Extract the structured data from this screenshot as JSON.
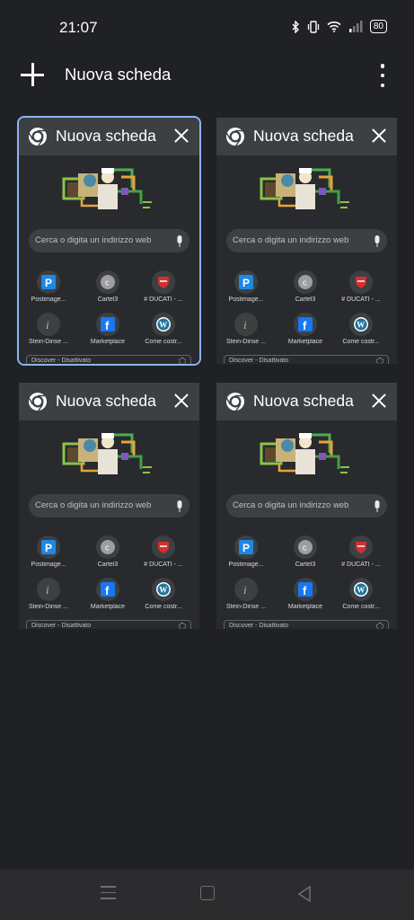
{
  "status": {
    "time": "21:07",
    "battery": "80"
  },
  "toolbar": {
    "title": "Nuova scheda"
  },
  "tabs": [
    {
      "title": "Nuova scheda",
      "selected": true
    },
    {
      "title": "Nuova scheda",
      "selected": false
    },
    {
      "title": "Nuova scheda",
      "selected": false
    },
    {
      "title": "Nuova scheda",
      "selected": false
    }
  ],
  "ntp": {
    "search_placeholder": "Cerca o digita un indirizzo web",
    "shortcuts": [
      {
        "label": "Postimage...",
        "icon": "postimage-icon"
      },
      {
        "label": "Cartel3",
        "icon": "cartel3-icon"
      },
      {
        "label": "# DUCATI - ...",
        "icon": "ducati-icon"
      },
      {
        "label": "Stein-Dinse ...",
        "icon": "stein-dinse-icon"
      },
      {
        "label": "Marketplace",
        "icon": "facebook-icon"
      },
      {
        "label": "Come costr...",
        "icon": "wordpress-icon"
      }
    ],
    "discover": "Discover - Disattivato"
  },
  "colors": {
    "accent": "#8ab4f8",
    "background": "#202124",
    "card_header": "#3c4043"
  }
}
